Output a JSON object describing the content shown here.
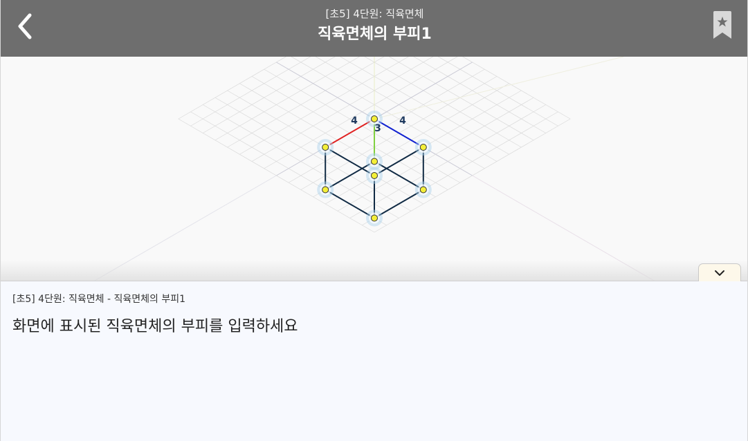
{
  "header": {
    "back_icon": "chevron-left-icon",
    "subtitle": "[초5] 4단원: 직육면체",
    "title": "직육면체의 부피1",
    "bookmark_icon": "bookmark-star-icon"
  },
  "viewer": {
    "edge_labels": {
      "red": "4",
      "blue": "4",
      "green": "3"
    },
    "colors": {
      "edge_red": "#e02020",
      "edge_blue": "#1020d0",
      "edge_green": "#80d040",
      "edge_default": "#102a44",
      "vertex_fill": "#f4ef3a",
      "vertex_halo": "#a9d0ea"
    },
    "collapse_icon": "chevron-down-icon"
  },
  "question": {
    "breadcrumb": "[초5] 4단원: 직육면체 - 직육면체의 부피1",
    "prompt": "화면에 표시된 직육면체의 부피를 입력하세요"
  }
}
